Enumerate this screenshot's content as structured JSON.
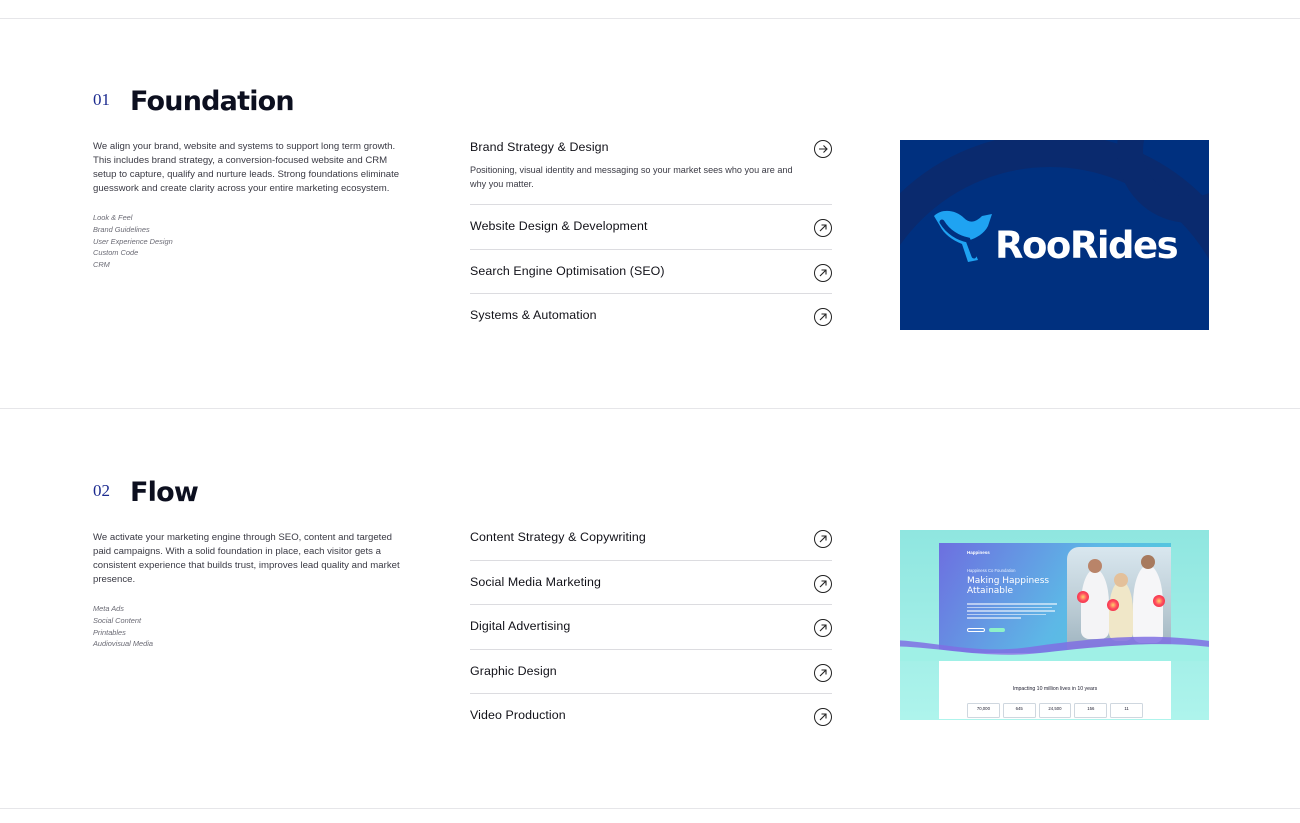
{
  "sections": [
    {
      "number": "01",
      "title": "Foundation",
      "description": "We align your brand, website and systems to support long term growth. This includes brand strategy, a conversion-focused website and CRM setup to capture, qualify and nurture leads. Strong foundations eliminate guesswork and create clarity across your entire marketing ecosystem.",
      "tags": [
        "Look & Feel",
        "Brand Guidelines",
        "User Experience Design",
        "Custom Code",
        "CRM"
      ],
      "services": [
        {
          "title": "Brand Strategy & Design",
          "subtitle": "Positioning, visual identity and messaging so your market sees who you are and why you matter.",
          "icon": "arrow-right-circle-icon"
        },
        {
          "title": "Website Design & Development",
          "icon": "arrow-up-right-circle-icon"
        },
        {
          "title": "Search Engine Optimisation (SEO)",
          "icon": "arrow-up-right-circle-icon"
        },
        {
          "title": "Systems & Automation",
          "icon": "arrow-up-right-circle-icon"
        }
      ],
      "image": {
        "brand": "RooRides",
        "background": "#00307f",
        "accent": "#1fa3f2"
      }
    },
    {
      "number": "02",
      "title": "Flow",
      "description": "We activate your marketing engine through SEO, content and targeted paid campaigns. With a solid foundation in place, each visitor gets a consistent experience that builds trust, improves lead quality and market presence.",
      "tags": [
        "Meta Ads",
        "Social Content",
        "Printables",
        "Audiovisual Media"
      ],
      "services": [
        {
          "title": "Content Strategy & Copywriting",
          "icon": "arrow-up-right-circle-icon"
        },
        {
          "title": "Social Media Marketing",
          "icon": "arrow-up-right-circle-icon"
        },
        {
          "title": "Digital Advertising",
          "icon": "arrow-up-right-circle-icon"
        },
        {
          "title": "Graphic Design",
          "icon": "arrow-up-right-circle-icon"
        },
        {
          "title": "Video Production",
          "icon": "arrow-up-right-circle-icon"
        }
      ],
      "image": {
        "logo": "Happiness",
        "kicker": "Happiness Co Foundation",
        "headline": "Making Happiness Attainable",
        "stats_title": "Impacting 10 million lives in 10 years",
        "stats": [
          "70,000",
          "645",
          "24,500",
          "156",
          "11"
        ]
      }
    }
  ],
  "colors": {
    "number": "#1b2a8f",
    "heading": "#0c0f1f",
    "divider": "#e6e6e9"
  }
}
